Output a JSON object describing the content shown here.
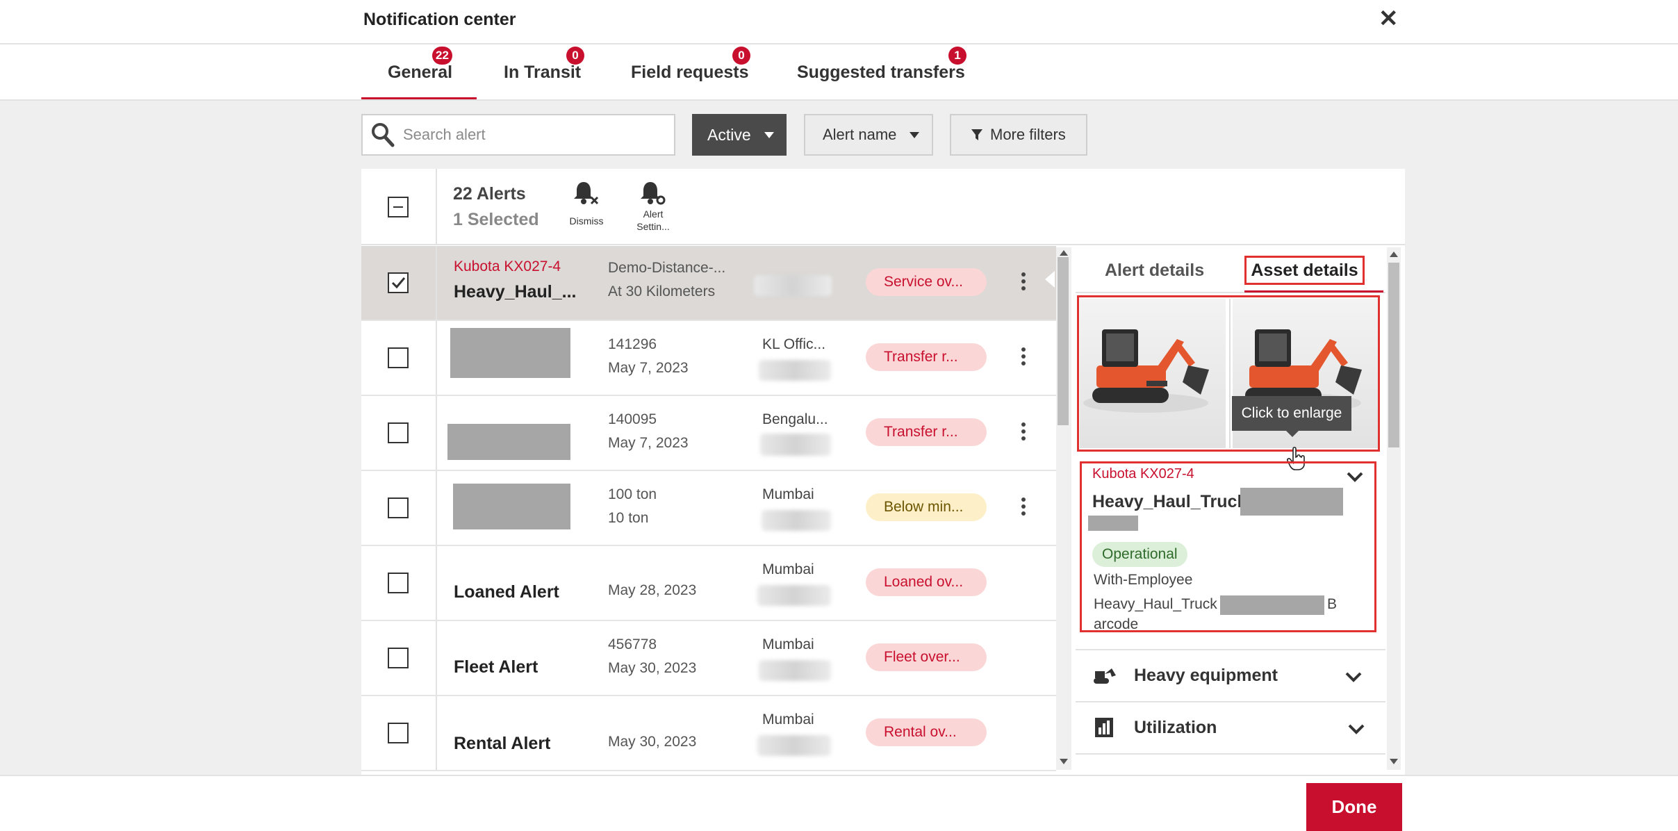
{
  "header": {
    "title": "Notification center"
  },
  "tabs": [
    {
      "label": "General",
      "count": "22"
    },
    {
      "label": "In Transit",
      "count": "0"
    },
    {
      "label": "Field requests",
      "count": "0"
    },
    {
      "label": "Suggested transfers",
      "count": "1"
    }
  ],
  "filters": {
    "search_placeholder": "Search alert",
    "status": "Active",
    "alert_name": "Alert name",
    "more": "More filters"
  },
  "list_header": {
    "count": "22 Alerts",
    "selected": "1 Selected",
    "dismiss": "Dismiss",
    "settings_a": "Alert",
    "settings_b": "Settin..."
  },
  "rows": [
    {
      "sub": "Kubota KX027-4",
      "name": "Heavy_Haul_...",
      "c2a": "Demo-Distance-...",
      "c2b": "At 30 Kilometers",
      "c3": "",
      "status": "Service ov..."
    },
    {
      "sub": "",
      "name": "",
      "c2a": "141296",
      "c2b": "May 7, 2023",
      "c3": "KL Offic...",
      "status": "Transfer r..."
    },
    {
      "sub": "",
      "name": "",
      "c2a": "140095",
      "c2b": "May 7, 2023",
      "c3": "Bengalu...",
      "status": "Transfer r..."
    },
    {
      "sub": "",
      "name": "",
      "c2a": "100 ton",
      "c2b": "10 ton",
      "c3": "Mumbai",
      "status": "Below min..."
    },
    {
      "sub": "",
      "name": "Loaned Alert",
      "c2a": "",
      "c2b": "May 28, 2023",
      "c3": "Mumbai",
      "status": "Loaned ov..."
    },
    {
      "sub": "",
      "name": "Fleet Alert",
      "c2a": "456778",
      "c2b": "May 30, 2023",
      "c3": "Mumbai",
      "status": "Fleet over..."
    },
    {
      "sub": "",
      "name": "Rental Alert",
      "c2a": "",
      "c2b": "May 30, 2023",
      "c3": "Mumbai",
      "status": "Rental ov..."
    }
  ],
  "detail": {
    "tab_alert": "Alert details",
    "tab_asset": "Asset details",
    "tooltip": "Click to enlarge",
    "model": "Kubota KX027-4",
    "name": "Heavy_Haul_Truck",
    "status": "Operational",
    "custody": "With-Employee",
    "barcode_prefix": "Heavy_Haul_Truck",
    "barcode_tail_a": "B",
    "barcode_tail_b": "arcode",
    "sections": [
      "Heavy equipment",
      "Utilization"
    ]
  },
  "footer": {
    "done": "Done"
  },
  "colors": {
    "accent": "#c8102e",
    "selected_row": "#dcd9d6",
    "highlight_box": "#e03030"
  }
}
